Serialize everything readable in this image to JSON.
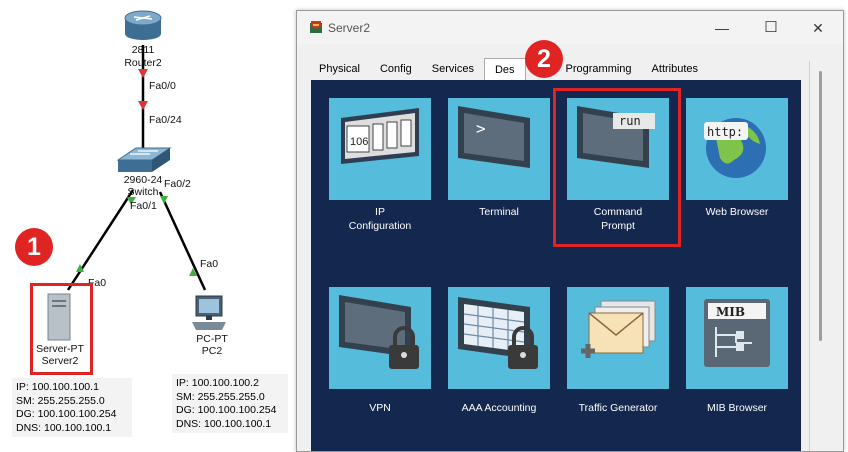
{
  "topology": {
    "router": {
      "model": "2811",
      "name": "Router2"
    },
    "switch": {
      "model": "2960-24",
      "name": "Switch"
    },
    "server": {
      "type": "Server-PT",
      "name": "Server2"
    },
    "pc": {
      "type": "PC-PT",
      "name": "PC2"
    },
    "ports": {
      "router_fa0_0": "Fa0/0",
      "switch_fa0_24": "Fa0/24",
      "switch_fa0_2": "Fa0/2",
      "switch_fa0_1": "Fa0/1",
      "server_fa0": "Fa0",
      "pc_fa0": "Fa0"
    },
    "server_info": [
      "IP: 100.100.100.1",
      "SM: 255.255.255.0",
      "DG: 100.100.100.254",
      "DNS: 100.100.100.1"
    ],
    "pc_info": [
      "IP: 100.100.100.2",
      "SM: 255.255.255.0",
      "DG: 100.100.100.254",
      "DNS: 100.100.100.1"
    ]
  },
  "markers": {
    "one": "1",
    "two": "2"
  },
  "window": {
    "title": "Server2",
    "controls": {
      "minimize": "—",
      "maximize": "☐",
      "close": "✕"
    },
    "tabs": [
      {
        "label": "Physical"
      },
      {
        "label": "Config"
      },
      {
        "label": "Services"
      },
      {
        "label": "Des"
      },
      {
        "label": "Programming"
      },
      {
        "label": "Attributes"
      }
    ],
    "active_tab": "Desktop",
    "apps": [
      {
        "label_1": "IP",
        "label_2": "Configuration",
        "icon": "ip-config-icon",
        "icon_text": "106"
      },
      {
        "label_1": "Terminal",
        "label_2": "",
        "icon": "terminal-icon",
        "icon_text": ">"
      },
      {
        "label_1": "Command",
        "label_2": "Prompt",
        "icon": "command-prompt-icon",
        "icon_text": "run"
      },
      {
        "label_1": "Web Browser",
        "label_2": "",
        "icon": "web-browser-icon",
        "icon_text": "http:"
      },
      {
        "label_1": "VPN",
        "label_2": "",
        "icon": "vpn-icon",
        "icon_text": ""
      },
      {
        "label_1": "AAA Accounting",
        "label_2": "",
        "icon": "aaa-accounting-icon",
        "icon_text": ""
      },
      {
        "label_1": "Traffic Generator",
        "label_2": "",
        "icon": "traffic-generator-icon",
        "icon_text": ""
      },
      {
        "label_1": "MIB Browser",
        "label_2": "",
        "icon": "mib-browser-icon",
        "icon_text": "MIB"
      }
    ]
  },
  "colors": {
    "panel_bg": "#14274e",
    "tile_bg": "#55bcdb",
    "highlight": "#e02424",
    "link_green": "#3cb043",
    "link_red": "#e0323b"
  }
}
